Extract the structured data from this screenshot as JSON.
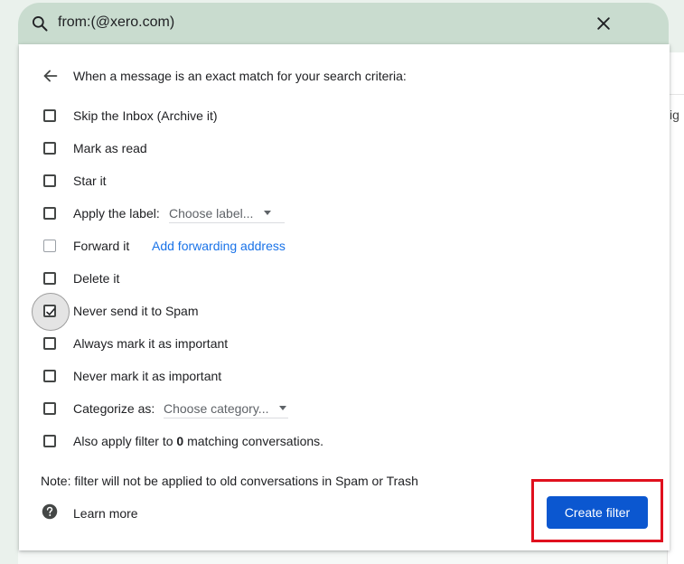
{
  "search": {
    "query": "from:(@xero.com)"
  },
  "background": {
    "partial_text": "ig"
  },
  "dialog": {
    "header": "When a message is an exact match for your search criteria:",
    "options": [
      {
        "label": "Skip the Inbox (Archive it)",
        "checked": false
      },
      {
        "label": "Mark as read",
        "checked": false
      },
      {
        "label": "Star it",
        "checked": false
      },
      {
        "label": "Apply the label:",
        "checked": false,
        "select": "Choose label..."
      },
      {
        "label": "Forward it",
        "checked": false,
        "disabled": true,
        "link": "Add forwarding address"
      },
      {
        "label": "Delete it",
        "checked": false
      },
      {
        "label": "Never send it to Spam",
        "checked": true
      },
      {
        "label": "Always mark it as important",
        "checked": false
      },
      {
        "label": "Never mark it as important",
        "checked": false
      },
      {
        "label": "Categorize as:",
        "checked": false,
        "select": "Choose category..."
      },
      {
        "label_prefix": "Also apply filter to ",
        "label_count": "0",
        "label_suffix": " matching conversations.",
        "checked": false
      }
    ],
    "note": "Note: filter will not be applied to old conversations in Spam or Trash",
    "learn_more": "Learn more",
    "create_button": "Create filter"
  },
  "colors": {
    "search_bar_bg": "#c9dccf",
    "primary_button": "#0b57d0",
    "link": "#1a73e8",
    "highlight": "#e0101e"
  }
}
